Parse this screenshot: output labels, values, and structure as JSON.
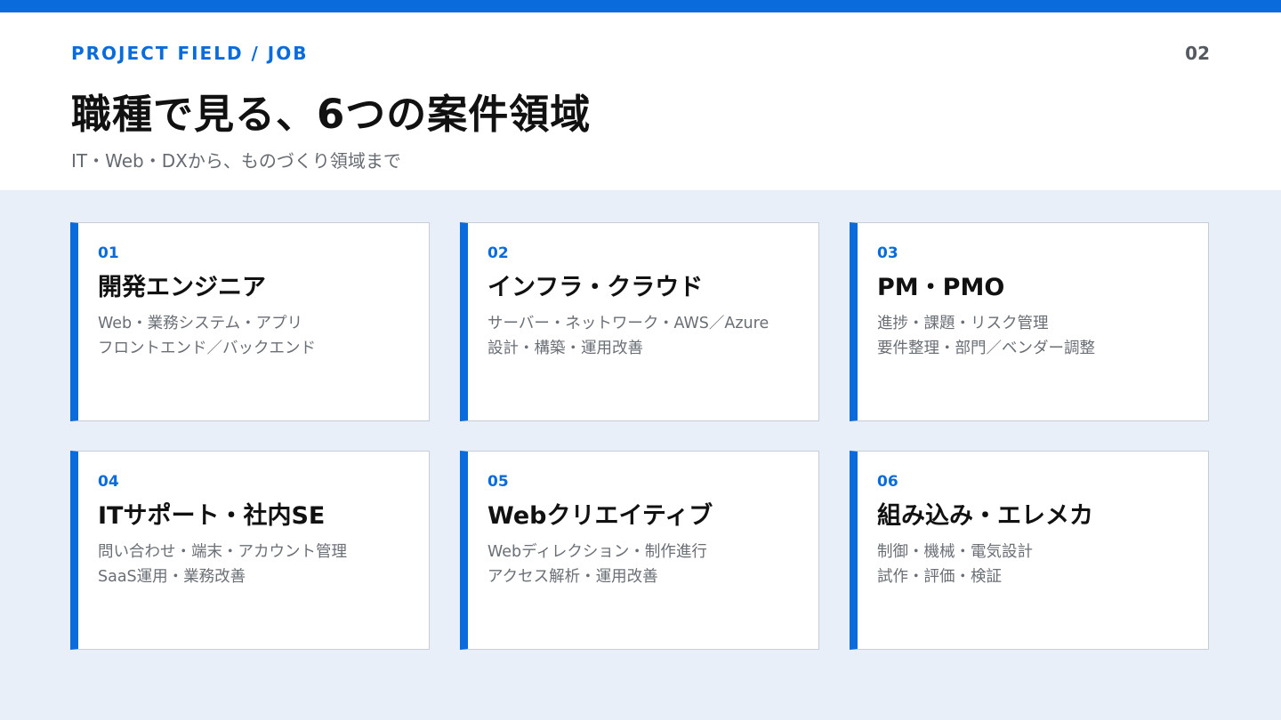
{
  "header": {
    "eyebrow": "PROJECT FIELD / JOB",
    "page_number": "02",
    "title": "職種で見る、6つの案件領域",
    "subtitle": "IT・Web・DXから、ものづくり領域まで"
  },
  "cards": [
    {
      "number": "01",
      "title": "開発エンジニア",
      "lines": [
        "Web・業務システム・アプリ",
        "フロントエンド／バックエンド"
      ]
    },
    {
      "number": "02",
      "title": "インフラ・クラウド",
      "lines": [
        "サーバー・ネットワーク・AWS／Azure",
        "設計・構築・運用改善"
      ]
    },
    {
      "number": "03",
      "title": "PM・PMO",
      "lines": [
        "進捗・課題・リスク管理",
        "要件整理・部門／ベンダー調整"
      ]
    },
    {
      "number": "04",
      "title": "ITサポート・社内SE",
      "lines": [
        "問い合わせ・端末・アカウント管理",
        "SaaS運用・業務改善"
      ]
    },
    {
      "number": "05",
      "title": "Webクリエイティブ",
      "lines": [
        "Webディレクション・制作進行",
        "アクセス解析・運用改善"
      ]
    },
    {
      "number": "06",
      "title": "組み込み・エレメカ",
      "lines": [
        "制御・機械・電気設計",
        "試作・評価・検証"
      ]
    }
  ],
  "colors": {
    "accent": "#0a6bdc",
    "background": "#e8eff9",
    "title": "#111111",
    "body_text": "#6a6f76"
  }
}
